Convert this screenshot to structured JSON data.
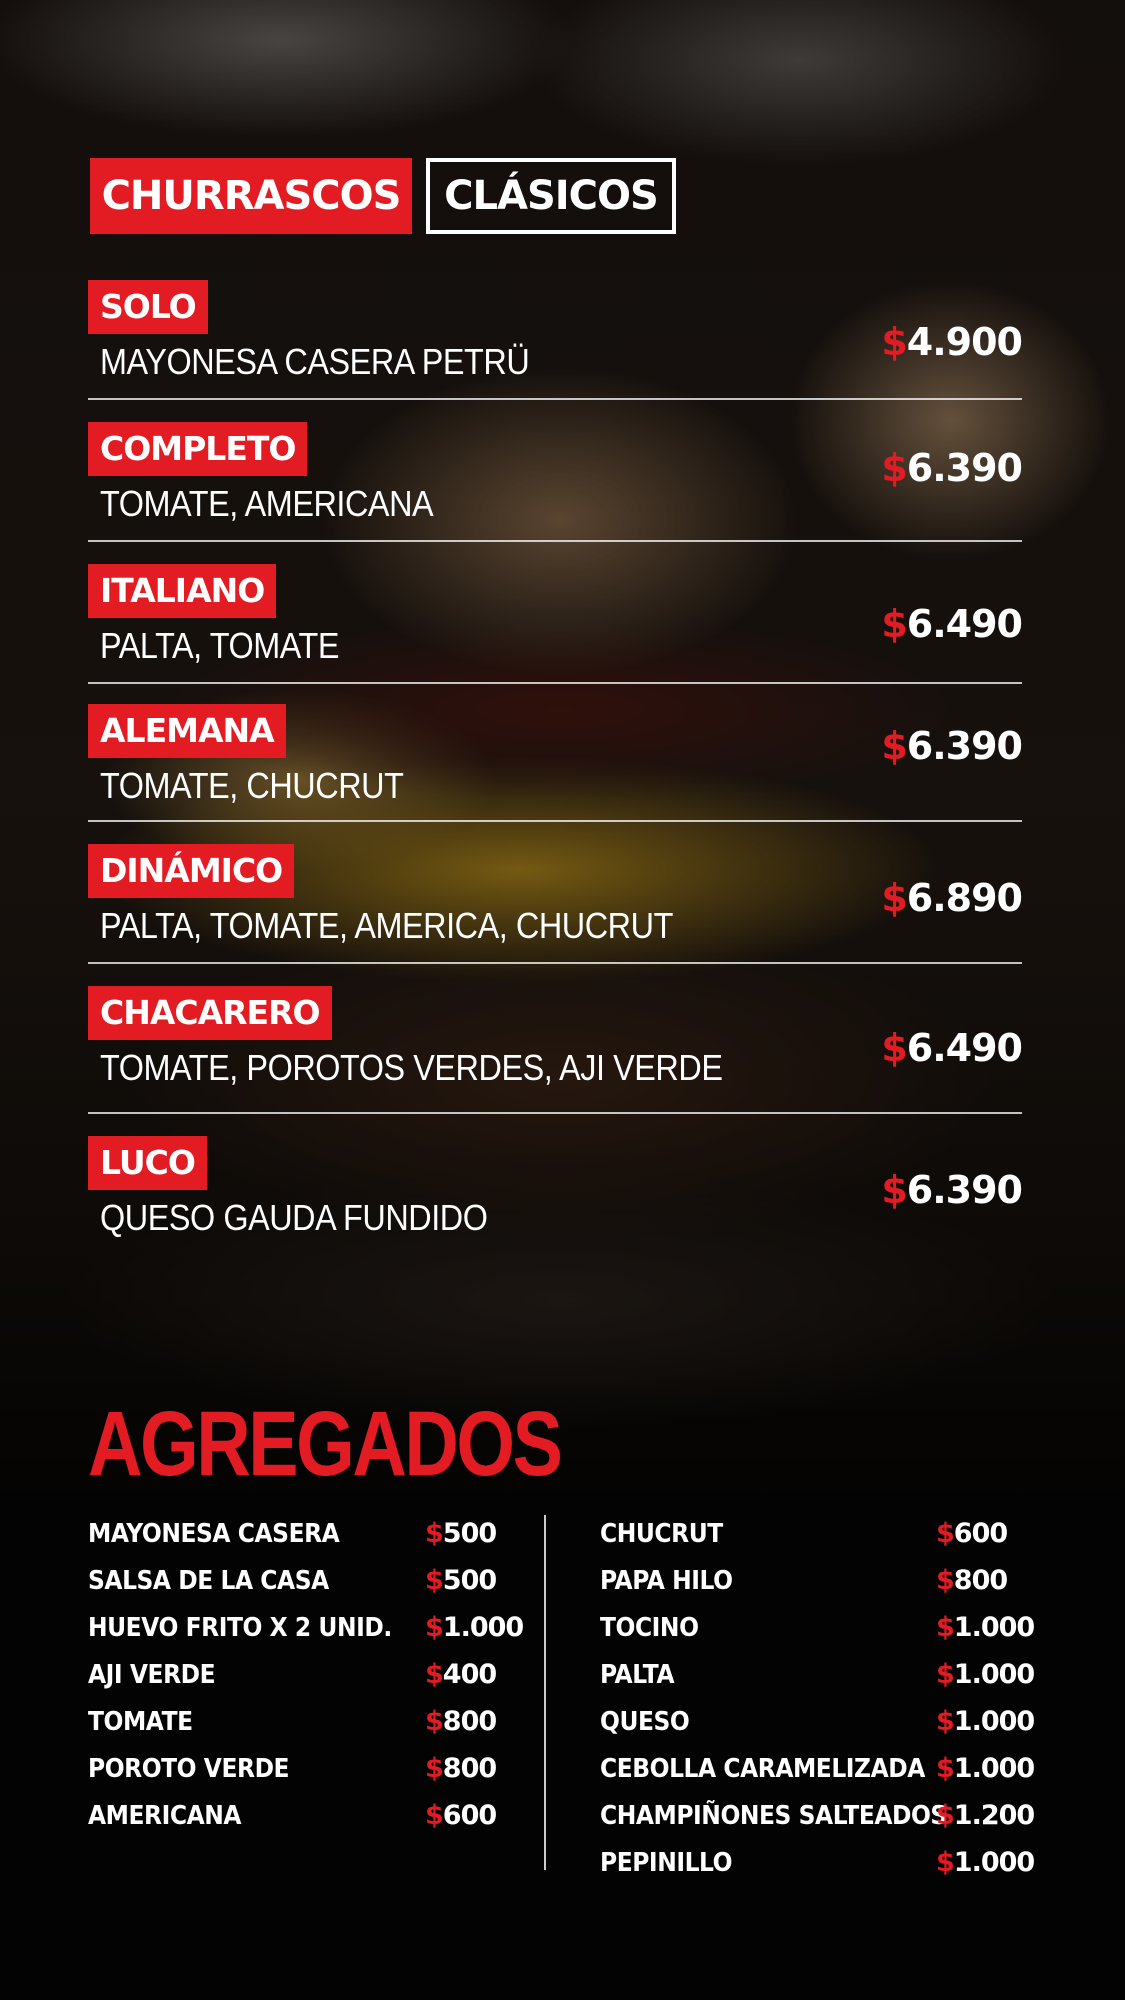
{
  "tabs": {
    "active": "CHURRASCOS",
    "secondary": "CLÁSICOS"
  },
  "currency_symbol": "$",
  "menu_items": [
    {
      "name": "SOLO",
      "description": "MAYONESA CASERA PETRÜ",
      "price": "4.900"
    },
    {
      "name": "COMPLETO",
      "description": "TOMATE, AMERICANA",
      "price": "6.390"
    },
    {
      "name": "ITALIANO",
      "description": "PALTA, TOMATE",
      "price": "6.490"
    },
    {
      "name": "ALEMANA",
      "description": "TOMATE, CHUCRUT",
      "price": "6.390"
    },
    {
      "name": "DINÁMICO",
      "description": "PALTA, TOMATE, AMERICA, CHUCRUT",
      "price": "6.890"
    },
    {
      "name": "CHACARERO",
      "description": "TOMATE, POROTOS VERDES, AJI VERDE",
      "price": "6.490"
    },
    {
      "name": "LUCO",
      "description": "QUESO GAUDA FUNDIDO",
      "price": "6.390"
    }
  ],
  "agregados": {
    "title": "AGREGADOS",
    "left": [
      {
        "name": "MAYONESA CASERA",
        "price": "500"
      },
      {
        "name": "SALSA DE LA CASA",
        "price": "500"
      },
      {
        "name": "HUEVO FRITO X 2 UNID.",
        "price": "1.000"
      },
      {
        "name": "AJI VERDE",
        "price": "400"
      },
      {
        "name": "TOMATE",
        "price": "800"
      },
      {
        "name": "POROTO VERDE",
        "price": "800"
      },
      {
        "name": "AMERICANA",
        "price": "600"
      }
    ],
    "right": [
      {
        "name": "CHUCRUT",
        "price": "600"
      },
      {
        "name": "PAPA HILO",
        "price": "800"
      },
      {
        "name": "TOCINO",
        "price": "1.000"
      },
      {
        "name": "PALTA",
        "price": "1.000"
      },
      {
        "name": "QUESO",
        "price": "1.000"
      },
      {
        "name": "CEBOLLA CARAMELIZADA",
        "price": "1.000"
      },
      {
        "name": "CHAMPIÑONES SALTEADOS",
        "price": "1.200"
      },
      {
        "name": "PEPINILLO",
        "price": "1.000"
      }
    ]
  },
  "colors": {
    "accent": "#e31b23",
    "text": "#ffffff",
    "background": "#0b0806"
  }
}
